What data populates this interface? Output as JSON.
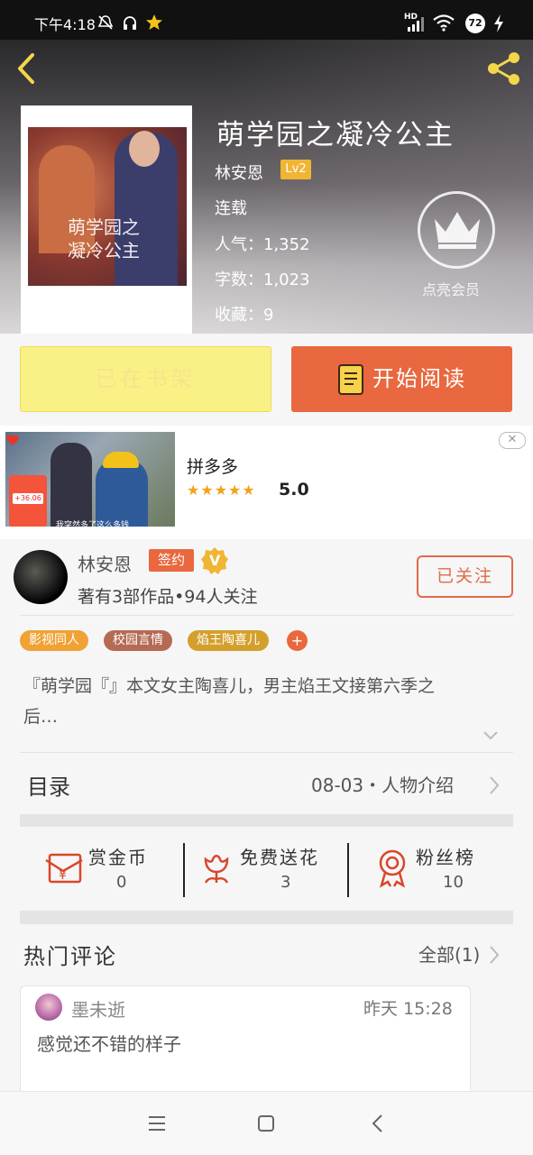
{
  "status_bar": {
    "time": "下午4:18",
    "hd": "HD",
    "battery": "72"
  },
  "header": {
    "book_title": "萌学园之凝冷公主",
    "author": "林安恩",
    "author_level": "Lv2",
    "status": "连载",
    "popularity": "人气：1,352",
    "word_count": "字数：1,023",
    "favorites": "收藏：9",
    "vip_label": "点亮会员",
    "cover_text_line1": "萌学园之",
    "cover_text_line2": "凝冷公主"
  },
  "actions": {
    "shelf_label": "已在书架",
    "read_label": "开始阅读"
  },
  "ad": {
    "name": "拼多多",
    "stars": "★★★★★",
    "rating": "5.0",
    "caption": "我突然多了这么多钱",
    "phone_amount": "+36.06",
    "close": "✕"
  },
  "author_card": {
    "name": "林安恩",
    "sign_badge": "签约",
    "v_badge": "V",
    "stats": "著有3部作品•94人关注",
    "follow_label": "已关注"
  },
  "tags": [
    "影视同人",
    "校园言情",
    "焰王陶喜儿"
  ],
  "tag_add": "+",
  "description": "『萌学园『』本文女主陶喜儿，男主焰王文接第六季之后…",
  "toc": {
    "label": "目录",
    "latest": "08-03・人物介绍"
  },
  "rewards": {
    "coins_label": "赏金币",
    "coins_value": "0",
    "flowers_label": "免费送花",
    "flowers_value": "3",
    "fans_label": "粉丝榜",
    "fans_value": "10"
  },
  "comments": {
    "section_title": "热门评论",
    "all_label": "全部(1)",
    "items": [
      {
        "user": "墨未逝",
        "time": "昨天 15:28",
        "text": "感觉还不错的样子"
      }
    ]
  },
  "colors": {
    "accent": "#e9683f",
    "shelf_yellow": "#faf186",
    "tag_orange": "#f0a234",
    "tag_brown": "#b56a54",
    "tag_gold": "#d4a02c"
  },
  "icons": [
    "back-icon",
    "share-icon",
    "crown-icon",
    "book-icon",
    "red-envelope-icon",
    "flower-icon",
    "medal-icon",
    "chevron-right-icon",
    "chevron-down-icon",
    "menu-icon",
    "home-icon",
    "back-nav-icon"
  ]
}
